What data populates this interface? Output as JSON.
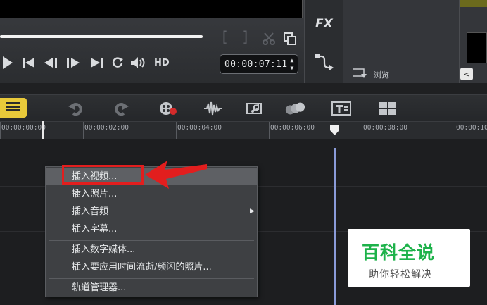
{
  "player": {
    "timecode": "00:00:07:11",
    "hd_label": "HD",
    "bracket_in": "[",
    "bracket_out": "]"
  },
  "effects": {
    "fx_label": "FX"
  },
  "library": {
    "browse_label": "浏览",
    "scroll_left_glyph": "<"
  },
  "ruler": {
    "ticks": [
      "00:00:00:00",
      "00:00:02:00",
      "00:00:04:00",
      "00:00:06:00",
      "00:00:08:00",
      "00:00:10"
    ]
  },
  "context_menu": {
    "items": [
      {
        "label": "插入视频..."
      },
      {
        "label": "插入照片..."
      },
      {
        "label": "插入音频"
      },
      {
        "label": "插入字幕..."
      },
      {
        "label": "插入数字媒体..."
      },
      {
        "label": "插入要应用时间流逝/频闪的照片..."
      },
      {
        "label": "轨道管理器..."
      }
    ],
    "submenu_arrow": "▶"
  },
  "watermark": {
    "title": "百科全说",
    "subtitle": "助你轻松解决"
  },
  "colors": {
    "accent_yellow": "#e8c93a",
    "annotation_red": "#e21e1e",
    "watermark_green": "#1db24a",
    "playhead_blue": "#8a9bd8"
  },
  "icons": {
    "player": [
      "play-icon",
      "go-to-start-icon",
      "previous-frame-icon",
      "next-frame-icon",
      "go-to-end-icon",
      "repeat-icon",
      "volume-icon"
    ],
    "toolbar": [
      "timeline-view-icon",
      "undo-icon",
      "redo-icon",
      "record-capture-icon",
      "sound-mixer-icon",
      "auto-music-icon",
      "motion-tracking-icon",
      "title-icon",
      "multi-camera-icon"
    ]
  }
}
